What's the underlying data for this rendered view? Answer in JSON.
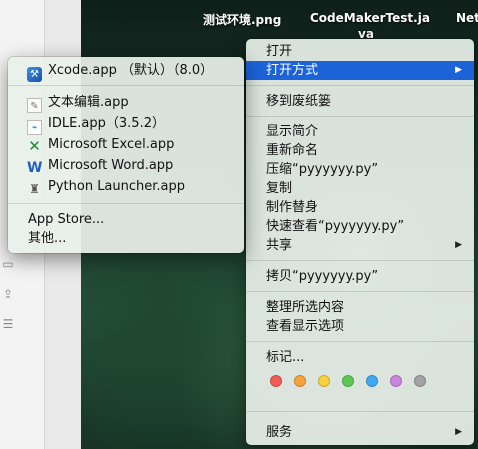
{
  "desktop": {
    "files": [
      {
        "label": "测试环境.png"
      },
      {
        "label": "CodeMakerTest.ja"
      },
      {
        "label": "Net"
      }
    ],
    "file_label_wrap": "va"
  },
  "context_menu": {
    "items": [
      {
        "label": "打开"
      },
      {
        "label": "打开方式",
        "submenu": true,
        "selected": true
      },
      {
        "label": "移到废纸篓"
      },
      {
        "label": "显示简介"
      },
      {
        "label": "重新命名"
      },
      {
        "label": "压缩“pyyyyyy.py”"
      },
      {
        "label": "复制"
      },
      {
        "label": "制作替身"
      },
      {
        "label": "快速查看“pyyyyyy.py”"
      },
      {
        "label": "共享",
        "submenu": true
      },
      {
        "label": "拷贝“pyyyyyy.py”"
      },
      {
        "label": "整理所选内容"
      },
      {
        "label": "查看显示选项"
      },
      {
        "label": "标记..."
      },
      {
        "label": "服务",
        "submenu": true
      }
    ],
    "tags": [
      {
        "name": "red",
        "color": "#f35b56"
      },
      {
        "name": "orange",
        "color": "#f7a23b"
      },
      {
        "name": "yellow",
        "color": "#f8d03d"
      },
      {
        "name": "green",
        "color": "#5dc953"
      },
      {
        "name": "blue",
        "color": "#3fa8f3"
      },
      {
        "name": "purple",
        "color": "#c886e0"
      },
      {
        "name": "gray",
        "color": "#a3a3a3"
      }
    ],
    "arrow_glyph": "▶"
  },
  "open_with_submenu": {
    "apps": [
      {
        "label": "Xcode.app （默认）（8.0）",
        "icon": "xcode-icon"
      },
      {
        "label": "文本编辑.app",
        "icon": "textedit-icon"
      },
      {
        "label": "IDLE.app（3.5.2）",
        "icon": "idle-icon"
      },
      {
        "label": "Microsoft Excel.app",
        "icon": "excel-icon"
      },
      {
        "label": "Microsoft Word.app",
        "icon": "word-icon"
      },
      {
        "label": "Python Launcher.app",
        "icon": "python-launcher-icon"
      }
    ],
    "app_store": "App Store...",
    "other": "其他..."
  }
}
